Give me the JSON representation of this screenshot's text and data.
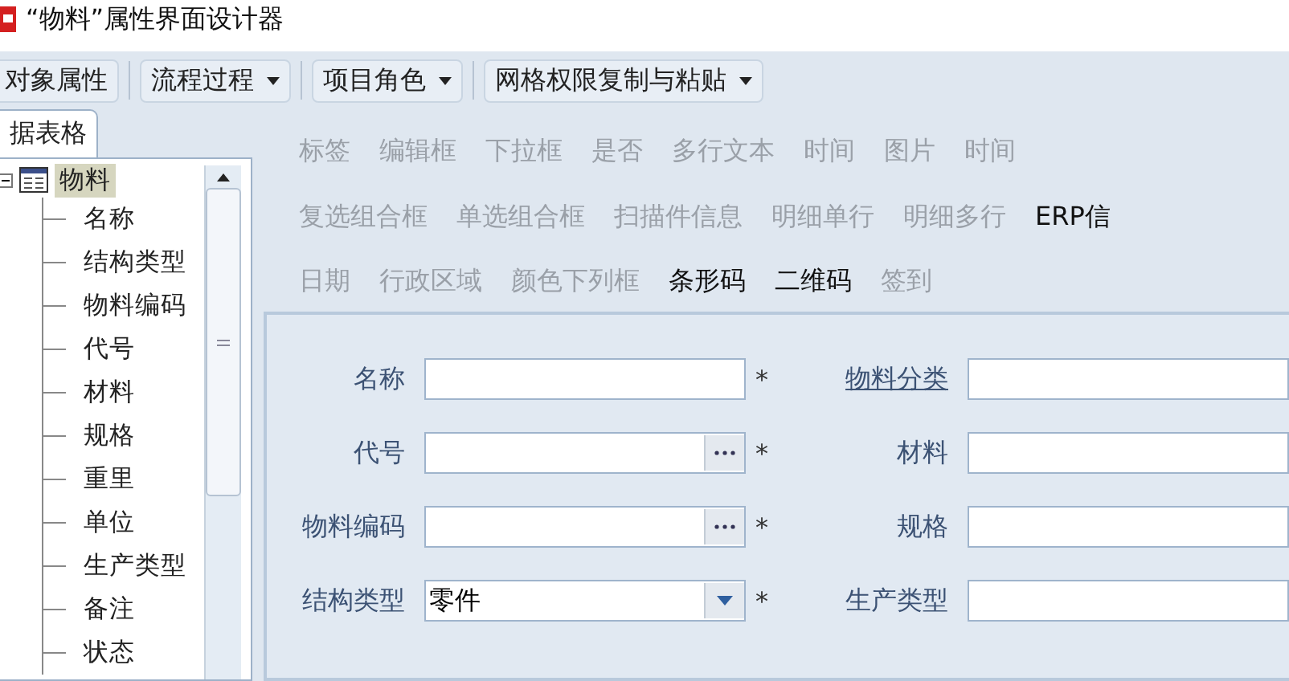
{
  "window": {
    "title": "“物料”属性界面设计器"
  },
  "toolbar": [
    {
      "label": "对象属性",
      "dropdown": false
    },
    {
      "label": "流程过程",
      "dropdown": true
    },
    {
      "label": "项目角色",
      "dropdown": true
    },
    {
      "label": "网格权限复制与粘贴",
      "dropdown": true
    }
  ],
  "tabs": [
    {
      "label": "据表格",
      "selected": true
    }
  ],
  "tree": {
    "label": "物料",
    "selected": true,
    "expanded": true,
    "children": [
      {
        "label": "名称",
        "selected": false
      },
      {
        "label": "结构类型",
        "selected": false
      },
      {
        "label": "物料编码",
        "selected": false
      },
      {
        "label": "代号",
        "selected": false
      },
      {
        "label": "材料",
        "selected": false
      },
      {
        "label": "规格",
        "selected": false
      },
      {
        "label": "重里",
        "selected": false
      },
      {
        "label": "单位",
        "selected": false
      },
      {
        "label": "生产类型",
        "selected": false
      },
      {
        "label": "备注",
        "selected": false
      },
      {
        "label": "状态",
        "selected": false
      }
    ]
  },
  "palette": [
    [
      {
        "label": "标签",
        "disabled": true
      },
      {
        "label": "编辑框",
        "disabled": true
      },
      {
        "label": "下拉框",
        "disabled": true
      },
      {
        "label": "是否",
        "disabled": true
      },
      {
        "label": "多行文本",
        "disabled": true
      },
      {
        "label": "时间",
        "disabled": true
      },
      {
        "label": "图片",
        "disabled": true
      },
      {
        "label": "时间",
        "disabled": true
      }
    ],
    [
      {
        "label": "复选组合框",
        "disabled": true
      },
      {
        "label": "单选组合框",
        "disabled": true
      },
      {
        "label": "扫描件信息",
        "disabled": true
      },
      {
        "label": "明细单行",
        "disabled": true
      },
      {
        "label": "明细多行",
        "disabled": true
      },
      {
        "label": "ERP信",
        "disabled": false
      }
    ],
    [
      {
        "label": "日期",
        "disabled": true
      },
      {
        "label": "行政区域",
        "disabled": true
      },
      {
        "label": "颜色下列框",
        "disabled": true
      },
      {
        "label": "条形码",
        "disabled": false
      },
      {
        "label": "二维码",
        "disabled": false
      },
      {
        "label": "签到",
        "disabled": true
      }
    ]
  ],
  "form": [
    {
      "left": {
        "label": "名称",
        "kind": "text",
        "required": "*"
      },
      "right": {
        "label": "物料分类",
        "link": true
      }
    },
    {
      "left": {
        "label": "代号",
        "kind": "lookup",
        "required": "*"
      },
      "right": {
        "label": "材料",
        "link": false
      }
    },
    {
      "left": {
        "label": "物料编码",
        "kind": "lookup",
        "required": "*"
      },
      "right": {
        "label": "规格",
        "link": false
      }
    },
    {
      "left": {
        "label": "结构类型",
        "kind": "dropdown",
        "value": "零件",
        "required": "*"
      },
      "right": {
        "label": "生产类型",
        "link": false
      }
    }
  ]
}
